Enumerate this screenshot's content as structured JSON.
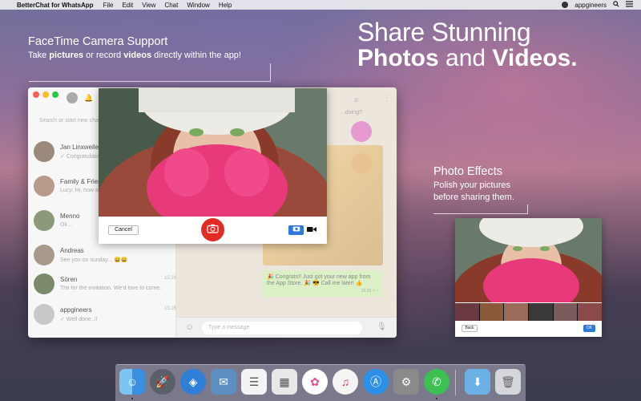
{
  "menubar": {
    "apple_glyph": "",
    "app_name": "BetterChat for WhatsApp",
    "items": [
      "File",
      "Edit",
      "View",
      "Chat",
      "Window",
      "Help"
    ],
    "user": "appgineers"
  },
  "hero": {
    "line1": "Share Stunning",
    "line2_a": "Photos",
    "line2_b": " and ",
    "line2_c": "Videos."
  },
  "facetime": {
    "title": "FaceTime Camera Support",
    "sub_a": "Take ",
    "sub_b": "pictures",
    "sub_c": " or record ",
    "sub_d": "videos",
    "sub_e": " directly within the app!"
  },
  "effects": {
    "title": "Photo Effects",
    "line1": "Polish your pictures",
    "line2": "before sharing them."
  },
  "sidebar": {
    "search_placeholder": "Search or start new chat",
    "chats": [
      {
        "name": "Jan Linxweiler",
        "msg": "✓ Congratulations!",
        "time": ""
      },
      {
        "name": "Family & Friends",
        "msg": "Lucy: Hi, how are you?",
        "time": ""
      },
      {
        "name": "Menno",
        "msg": "Ok...",
        "time": ""
      },
      {
        "name": "Andreas",
        "msg": "See you on sunday... 😄😄",
        "time": ""
      },
      {
        "name": "Sören",
        "msg": "Thx for the invitation. We'd love to come.",
        "time": "15:29"
      },
      {
        "name": "appgineers",
        "msg": "✓ Well done..!!",
        "time": "15:26"
      }
    ]
  },
  "conversation": {
    "bubble_top": "...doing?",
    "bubble_bottom": "🎉 Congrats!! Just got your new app from the App Store. 🎉 😎 Call me later! 👍",
    "bubble_time": "15:20 ✓✓",
    "compose_placeholder": "Type a message"
  },
  "camera": {
    "cancel_label": "Cancel",
    "shutter_icon": "camera-icon",
    "photo_mode_icon": "camera-icon",
    "video_mode_icon": "video-icon"
  },
  "fx_window": {
    "back_label": "Back",
    "ok_label": "OK",
    "thumb_colors": [
      "#6a3a40",
      "#8a5a3a",
      "#9a6a5a",
      "#3a3a3a",
      "#7a5a5a",
      "#8a4a4a"
    ]
  },
  "dock": {
    "apps": [
      {
        "name": "Finder",
        "color": "#3a8fe0"
      },
      {
        "name": "Launchpad",
        "color": "#5a5f6a"
      },
      {
        "name": "Safari",
        "color": "#2f7fd8"
      },
      {
        "name": "Mail",
        "color": "#5d8fc0"
      },
      {
        "name": "Reminders",
        "color": "#f4f4f4"
      },
      {
        "name": "Photo Booth",
        "color": "#e8e8e8"
      },
      {
        "name": "Photos",
        "color": "#ffffff"
      },
      {
        "name": "iTunes",
        "color": "#f4f4f4"
      },
      {
        "name": "App Store",
        "color": "#2d8fe6"
      },
      {
        "name": "System Preferences",
        "color": "#8a8a8a"
      },
      {
        "name": "WhatsApp",
        "color": "#3cc051"
      },
      {
        "name": "Downloads",
        "color": "#6cb1e6"
      },
      {
        "name": "Trash",
        "color": "#d4d8dc"
      }
    ]
  },
  "colors": {
    "accent_blue": "#2f78d9",
    "shutter_red": "#e22b24",
    "whatsapp_green": "#3cc051"
  }
}
